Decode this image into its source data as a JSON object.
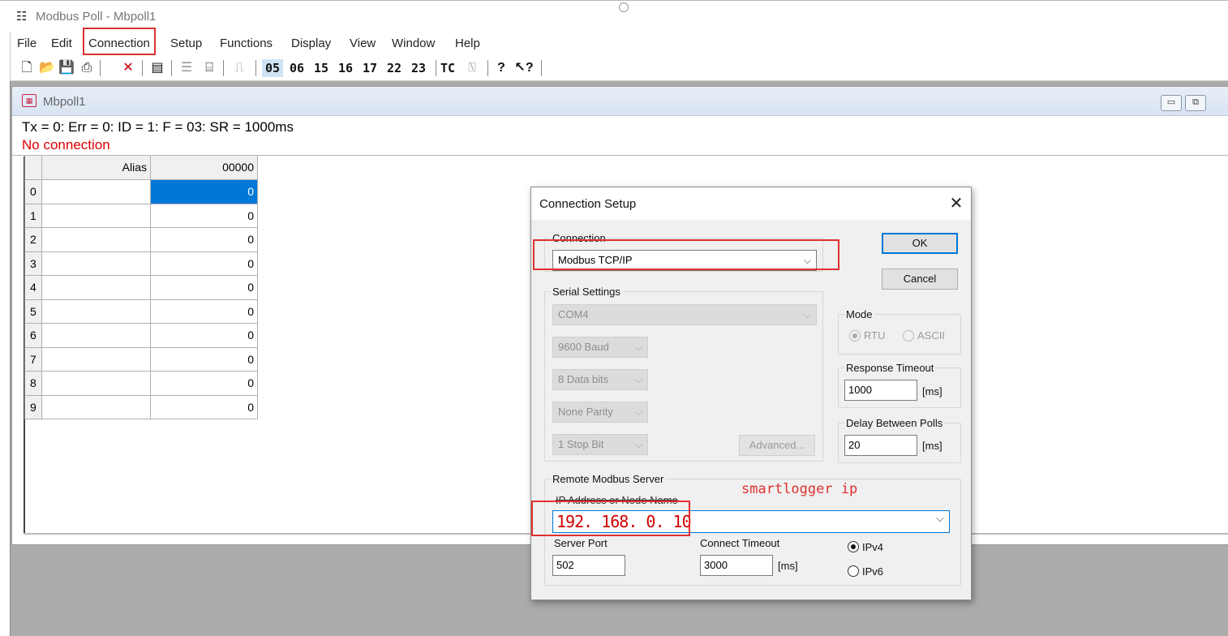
{
  "window": {
    "title": "Modbus Poll - Mbpoll1"
  },
  "menu": [
    "File",
    "Edit",
    "Connection",
    "Setup",
    "Functions",
    "Display",
    "View",
    "Window",
    "Help"
  ],
  "toolbar": {
    "function_codes": [
      "05",
      "06",
      "15",
      "16",
      "17",
      "22",
      "23"
    ],
    "tc_label": "TC",
    "help_glyph": "?",
    "whats_this_glyph": "↖?"
  },
  "child": {
    "title": "Mbpoll1",
    "status_line": "Tx = 0: Err = 0: ID = 1: F = 03: SR = 1000ms",
    "connection_status": "No connection"
  },
  "grid": {
    "headers": {
      "alias": "Alias",
      "address": "00000"
    },
    "rows": [
      {
        "num": "0",
        "alias": "",
        "value": "0",
        "selected": true
      },
      {
        "num": "1",
        "alias": "",
        "value": "0"
      },
      {
        "num": "2",
        "alias": "",
        "value": "0"
      },
      {
        "num": "3",
        "alias": "",
        "value": "0"
      },
      {
        "num": "4",
        "alias": "",
        "value": "0"
      },
      {
        "num": "5",
        "alias": "",
        "value": "0"
      },
      {
        "num": "6",
        "alias": "",
        "value": "0"
      },
      {
        "num": "7",
        "alias": "",
        "value": "0"
      },
      {
        "num": "8",
        "alias": "",
        "value": "0"
      },
      {
        "num": "9",
        "alias": "",
        "value": "0"
      }
    ]
  },
  "dialog": {
    "title": "Connection Setup",
    "close_glyph": "✕",
    "connection_label": "Connection",
    "connection_value": "Modbus TCP/IP",
    "ok_label": "OK",
    "cancel_label": "Cancel",
    "serial": {
      "label": "Serial Settings",
      "port": "COM4",
      "baud": "9600 Baud",
      "data_bits": "8 Data bits",
      "parity": "None Parity",
      "stop_bits": "1 Stop Bit",
      "advanced_label": "Advanced..."
    },
    "mode": {
      "label": "Mode",
      "rtu": "RTU",
      "ascii": "ASCII",
      "selected": "RTU"
    },
    "response_timeout": {
      "label": "Response Timeout",
      "value": "1000",
      "unit": "[ms]"
    },
    "delay_between_polls": {
      "label": "Delay Between Polls",
      "value": "20",
      "unit": "[ms]"
    },
    "remote": {
      "label": "Remote Modbus Server",
      "ip_label": "IP Address or Node Name",
      "ip_value": "192. 168. 0. 10",
      "server_port_label": "Server Port",
      "server_port_value": "502",
      "connect_timeout_label": "Connect Timeout",
      "connect_timeout_value": "3000",
      "connect_timeout_unit": "[ms]",
      "ipv4": "IPv4",
      "ipv6": "IPv6",
      "selected_ip_version": "IPv4"
    }
  },
  "annotation": {
    "text": "smartlogger ip",
    "color": "#e03030"
  },
  "colors": {
    "selection": "#0078d7",
    "error_text": "#e00000",
    "annotation": "#e03030"
  }
}
